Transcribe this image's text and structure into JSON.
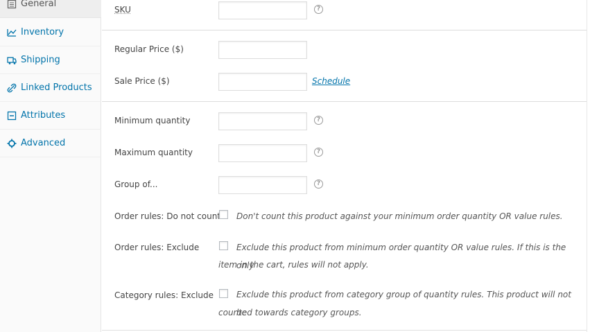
{
  "sidebar": {
    "tabs": [
      {
        "label": "General",
        "icon": "general-icon"
      },
      {
        "label": "Inventory",
        "icon": "inventory-icon"
      },
      {
        "label": "Shipping",
        "icon": "shipping-icon"
      },
      {
        "label": "Linked Products",
        "icon": "link-icon"
      },
      {
        "label": "Attributes",
        "icon": "attributes-icon"
      },
      {
        "label": "Advanced",
        "icon": "gear-icon"
      }
    ]
  },
  "fields": {
    "sku": {
      "label": "SKU",
      "value": ""
    },
    "regular_price": {
      "label": "Regular Price ($)",
      "value": ""
    },
    "sale_price": {
      "label": "Sale Price ($)",
      "value": ""
    },
    "schedule_link": "Schedule",
    "min_qty": {
      "label": "Minimum quantity",
      "value": ""
    },
    "max_qty": {
      "label": "Maximum quantity",
      "value": ""
    },
    "group_of": {
      "label": "Group of...",
      "value": ""
    },
    "help_glyph": "?"
  },
  "rules": {
    "do_not_count": {
      "label": "Order rules: Do not count",
      "checked": false,
      "desc": "Don't count this product against your minimum order quantity OR value rules."
    },
    "exclude": {
      "label": "Order rules: Exclude",
      "checked": false,
      "desc_line1": "Exclude this product from minimum order quantity OR value rules. If this is the only",
      "desc_line2": "item in the cart, rules will not apply."
    },
    "category_exclude": {
      "label": "Category rules: Exclude",
      "checked": false,
      "desc_line1": "Exclude this product from category group of quantity rules. This product will not be",
      "desc_line2": "counted towards category groups."
    }
  },
  "colors": {
    "link": "#0073aa",
    "active_tab_bg": "#eeeeee"
  }
}
